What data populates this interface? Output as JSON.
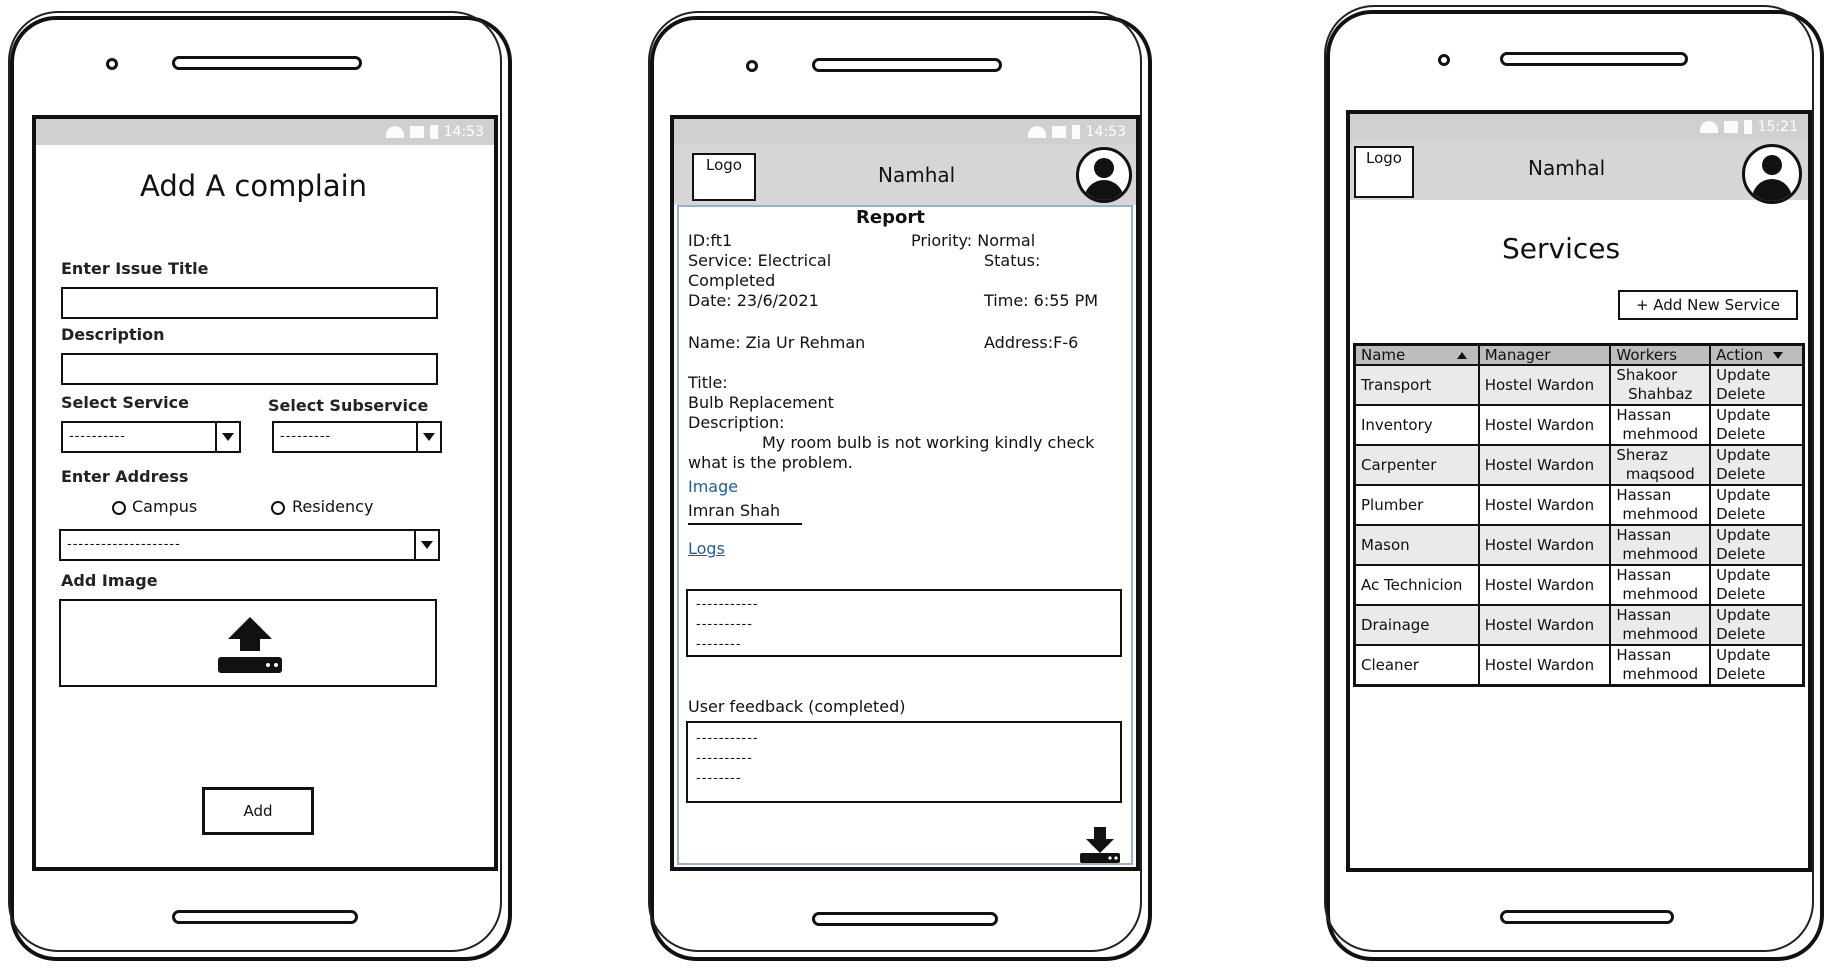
{
  "status_bars": {
    "phone1_time": "14:53",
    "phone2_time": "14:53",
    "phone3_time": "15:21"
  },
  "add_complain": {
    "title": "Add A complain",
    "issue_title_label": "Enter Issue Title",
    "description_label": "Description",
    "select_service_label": "Select Service",
    "select_subservice_label": "Select Subservice",
    "service_placeholder": "----------",
    "subservice_placeholder": "---------",
    "address_label": "Enter Address",
    "radio_campus": "Campus",
    "radio_residency": "Residency",
    "address_placeholder": "--------------------",
    "add_image_label": "Add Image",
    "add_button": "Add"
  },
  "header": {
    "logo": "Logo",
    "app_name": "Namhal"
  },
  "report": {
    "heading": "Report",
    "id": "ID:ft1",
    "priority": "Priority: Normal",
    "service": "Service: Electrical",
    "status_label": "Status:",
    "status_value": "Completed",
    "date": "Date: 23/6/2021",
    "time": "Time: 6:55 PM",
    "name": "Name: Zia Ur Rehman",
    "address": "Address:F-6",
    "title_label": "Title:",
    "title_value": "Bulb Replacement",
    "description_label": "Description:",
    "description_line1": "My room bulb is not working kindly check",
    "description_line2": "what is the problem.",
    "image_link": "Image",
    "assignee": "Imran Shah",
    "logs_link": "Logs",
    "logs_lines": [
      "-----------",
      "----------",
      "--------"
    ],
    "feedback_label": "User feedback (completed)",
    "feedback_lines": [
      "-----------",
      "----------",
      "--------"
    ]
  },
  "services": {
    "title": "Services",
    "add_button": "+ Add New Service",
    "columns": [
      "Name",
      "Manager",
      "Workers",
      "Action"
    ],
    "rows": [
      {
        "name": "Transport",
        "manager": "Hostel Wardon",
        "worker1": "Shakoor",
        "worker2": "Shahbaz",
        "action1": "Update",
        "action2": "Delete"
      },
      {
        "name": "Inventory",
        "manager": "Hostel Wardon",
        "worker1": "Hassan",
        "worker2": "mehmood",
        "action1": "Update",
        "action2": "Delete"
      },
      {
        "name": "Carpenter",
        "manager": "Hostel Wardon",
        "worker1": "Sheraz",
        "worker2": "maqsood",
        "action1": "Update",
        "action2": "Delete"
      },
      {
        "name": "Plumber",
        "manager": "Hostel Wardon",
        "worker1": "Hassan",
        "worker2": "mehmood",
        "action1": "Update",
        "action2": "Delete"
      },
      {
        "name": "Mason",
        "manager": "Hostel Wardon",
        "worker1": "Hassan",
        "worker2": "mehmood",
        "action1": "Update",
        "action2": "Delete"
      },
      {
        "name": "Ac Technicion",
        "manager": "Hostel Wardon",
        "worker1": "Hassan",
        "worker2": "mehmood",
        "action1": "Update",
        "action2": "Delete"
      },
      {
        "name": "Drainage",
        "manager": "Hostel Wardon",
        "worker1": "Hassan",
        "worker2": "mehmood",
        "action1": "Update",
        "action2": "Delete"
      },
      {
        "name": "Cleaner",
        "manager": "Hostel Wardon",
        "worker1": "Hassan",
        "worker2": "mehmood",
        "action1": "Update",
        "action2": "Delete"
      }
    ]
  }
}
